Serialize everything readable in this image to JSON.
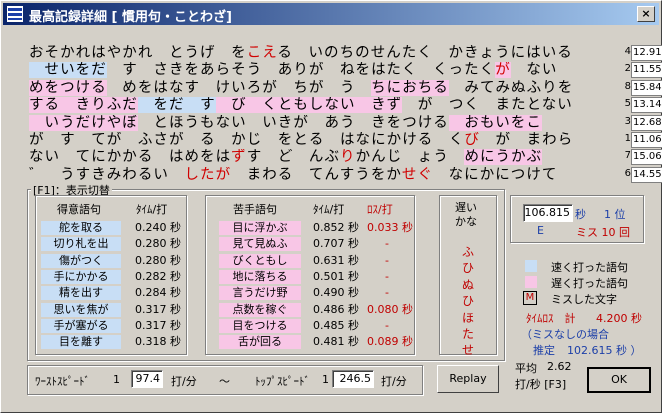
{
  "window": {
    "title": "最高記録詳細 [ 慣用句・ことわざ]",
    "close_glyph": "×"
  },
  "lines": [
    {
      "num": "4",
      "time": "12.910",
      "segments": [
        {
          "t": "おそかれはやかれ　とうげ　を",
          "c": ""
        },
        {
          "t": "こ",
          "c": "mistake"
        },
        {
          "t": "え",
          "c": "mistake"
        },
        {
          "t": "る　いのちのせんたく　かきょうにはいる",
          "c": ""
        }
      ]
    },
    {
      "num": "2",
      "time": "11.554",
      "segments": [
        {
          "t": "　せいをだ",
          "c": "fast"
        },
        {
          "t": "　す　さきをあらそう　ありが　ねをはたく　くったく",
          "c": ""
        },
        {
          "t": "が",
          "c": "slow mistake"
        },
        {
          "t": "　ない",
          "c": ""
        }
      ]
    },
    {
      "num": "8",
      "time": "15.841",
      "segments": [
        {
          "t": "めをつける",
          "c": "slow"
        },
        {
          "t": "　めをはなす　けいろが　ちが　う　",
          "c": ""
        },
        {
          "t": "ちにおちる",
          "c": "slow"
        },
        {
          "t": "　みてみぬふりを",
          "c": ""
        }
      ]
    },
    {
      "num": "5",
      "time": "13.140",
      "segments": [
        {
          "t": "する　きりふだ",
          "c": "slow"
        },
        {
          "t": "　をだ",
          "c": "fast"
        },
        {
          "t": "　す",
          "c": "fast"
        },
        {
          "t": "　び　くともしない　きず",
          "c": "slow"
        },
        {
          "t": "　が　つく　またとない",
          "c": ""
        }
      ]
    },
    {
      "num": "3",
      "time": "12.683",
      "segments": [
        {
          "t": "　いうだ",
          "c": "slow"
        },
        {
          "t": "けやぼ",
          "c": "slow"
        },
        {
          "t": "　とほうもない　いきが　あう　きをつける",
          "c": ""
        },
        {
          "t": "　おもいをこ",
          "c": "slow"
        }
      ]
    },
    {
      "num": "1",
      "time": "11.063",
      "segments": [
        {
          "t": "が　す　てが　ふさが　る　かじ",
          "c": ""
        },
        {
          "t": "　をとる　はなにかける　く",
          "c": ""
        },
        {
          "t": "び",
          "c": "mistake"
        },
        {
          "t": "　が　まわら",
          "c": ""
        }
      ]
    },
    {
      "num": "7",
      "time": "15.069",
      "segments": [
        {
          "t": "ない　てにかかる　はめをは",
          "c": ""
        },
        {
          "t": "ず",
          "c": "mistake"
        },
        {
          "t": "す　ど　んぶ",
          "c": ""
        },
        {
          "t": "り",
          "c": "mistake"
        },
        {
          "t": "かんじ　ょう　",
          "c": ""
        },
        {
          "t": "めにうかぶ",
          "c": "slow"
        }
      ]
    },
    {
      "num": "6",
      "time": "14.555",
      "segments": [
        {
          "t": "゛　うすきみわるい　",
          "c": ""
        },
        {
          "t": "したが",
          "c": "mistake"
        },
        {
          "t": "　まわる　てんすうをか",
          "c": ""
        },
        {
          "t": "せ",
          "c": "mistake"
        },
        {
          "t": "ぐ",
          "c": "mistake"
        },
        {
          "t": "　なにかにつけて",
          "c": ""
        }
      ]
    }
  ],
  "panel": {
    "title": "[F1]：表示切替",
    "good": {
      "header_word": "得意語句",
      "header_time": "ﾀｲﾑ/打",
      "rows": [
        {
          "word": "舵を取る",
          "time": "0.240 秒"
        },
        {
          "word": "切り札を出",
          "time": "0.280 秒"
        },
        {
          "word": "傷がつく",
          "time": "0.280 秒"
        },
        {
          "word": "手にかかる",
          "time": "0.282 秒"
        },
        {
          "word": "精を出す",
          "time": "0.284 秒"
        },
        {
          "word": "思いを焦が",
          "time": "0.317 秒"
        },
        {
          "word": "手が塞がる",
          "time": "0.317 秒"
        },
        {
          "word": "目を離す",
          "time": "0.318 秒"
        }
      ]
    },
    "bad": {
      "header_word": "苦手語句",
      "header_time": "ﾀｲﾑ/打",
      "header_loss": "ﾛｽ/打",
      "rows": [
        {
          "word": "目に浮かぶ",
          "time": "0.852 秒",
          "loss": "0.033 秒"
        },
        {
          "word": "見て見ぬふ",
          "time": "0.707 秒",
          "loss": "-"
        },
        {
          "word": "びくともし",
          "time": "0.631 秒",
          "loss": "-"
        },
        {
          "word": "地に落ちる",
          "time": "0.501 秒",
          "loss": "-"
        },
        {
          "word": "言うだけ野",
          "time": "0.490 秒",
          "loss": "-"
        },
        {
          "word": "点数を稼ぐ",
          "time": "0.486 秒",
          "loss": "0.080 秒"
        },
        {
          "word": "目をつける",
          "time": "0.485 秒",
          "loss": "-"
        },
        {
          "word": "舌が回る",
          "time": "0.481 秒",
          "loss": "0.089 秒"
        }
      ]
    },
    "slow": {
      "header": "遅い\nかな",
      "kana": [
        "ふ",
        "ひ",
        "ぬ",
        "ひ",
        "ほ",
        "た",
        "せ"
      ]
    }
  },
  "stats": {
    "time_value": "106.815",
    "time_unit": "秒",
    "rank": "1 位",
    "grade": "E",
    "miss": "ミス 10 回",
    "legend_fast": "速く打った語句",
    "legend_slow": "遅く打った語句",
    "legend_miss_box": "M",
    "legend_miss": "ミスした文字",
    "timeloss_label": "ﾀｲﾑﾛｽ　計",
    "timeloss_value": "4.200 秒",
    "nomiss_label": "（ミスなしの場合",
    "estimate_label": "推定",
    "estimate_value": "102.615 秒 ）"
  },
  "speed": {
    "worst_label": "ﾜｰｽﾄｽﾋﾟｰﾄﾞ",
    "worst_idx": "1",
    "worst_value": "97.4",
    "unit": "打/分",
    "tilde": "〜",
    "top_label": "ﾄｯﾌﾟｽﾋﾟｰﾄﾞ",
    "top_idx": "1",
    "top_value": "246.5"
  },
  "buttons": {
    "replay": "Replay",
    "ok": "OK"
  },
  "average": {
    "label": "平均",
    "value": "2.62",
    "unit": "打/秒 [F3]"
  }
}
